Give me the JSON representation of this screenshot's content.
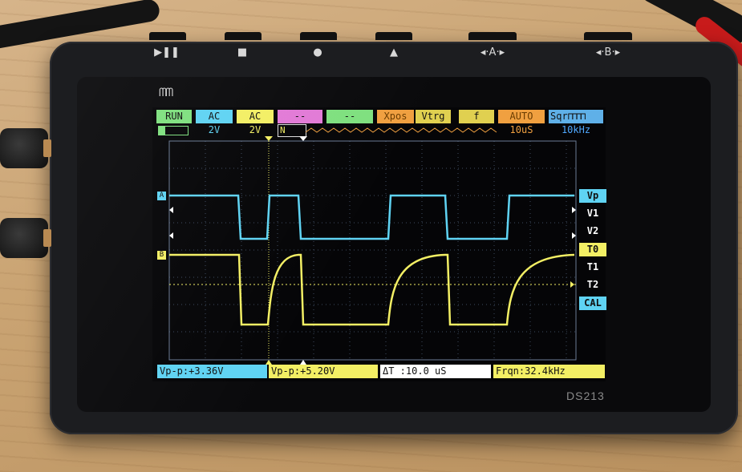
{
  "device": {
    "model": "DS213",
    "logo": "ᗰᗰ",
    "buttons": [
      "▶❚❚",
      "■",
      "●",
      "▲",
      "◂·A·▸",
      "◂·B·▸"
    ]
  },
  "top_bar": {
    "run": "RUN",
    "ch_a_coupling": "AC",
    "ch_a_scale": "2V",
    "ch_b_coupling": "AC",
    "ch_b_scale": "2V",
    "ch_c": "--",
    "ch_d": "--",
    "xpos": "Xpos",
    "vtrg": "Vtrg",
    "f_label": "f",
    "trigger_mode": "AUTO",
    "timebase": "10uS",
    "wave_out": "Sqr",
    "wave_freq": "10kHz",
    "trigger_edge": "N"
  },
  "right_menu": [
    "Vp",
    "V1",
    "V2",
    "T0",
    "T1",
    "T2",
    "CAL"
  ],
  "measurements": {
    "ch_a": "Vp-p:+3.36V",
    "ch_b": "Vp-p:+5.20V",
    "delta_t": "ΔT :10.0 uS",
    "freq": "Frqn:32.4kHz"
  },
  "channel_markers": {
    "a": "A",
    "b": "B"
  },
  "colors": {
    "cyan": "#5fd3f3",
    "yellow": "#f3ef64",
    "green": "#7fe07f",
    "magenta": "#e27ad6",
    "orange": "#f0a040",
    "olive": "#e0d050",
    "grid": "#3d4a5f",
    "blue_text": "#4fa8ff"
  }
}
